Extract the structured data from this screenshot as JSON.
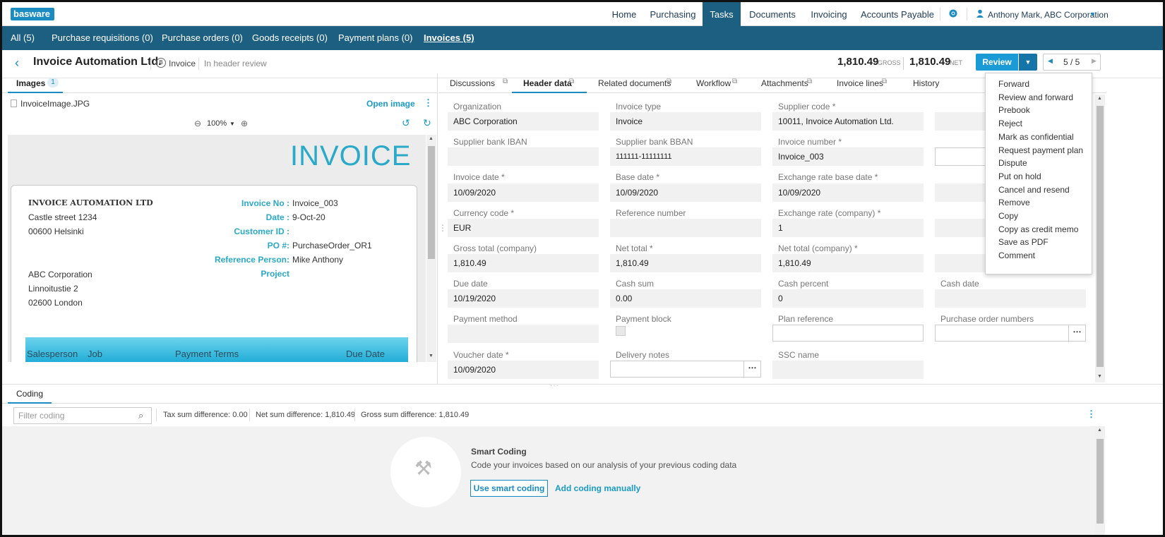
{
  "app": {
    "logo": "basware"
  },
  "top_nav": {
    "items": [
      "Home",
      "Purchasing",
      "Tasks",
      "Documents",
      "Invoicing",
      "Accounts Payable"
    ],
    "active": "Tasks",
    "user": "Anthony Mark, ABC Corporation"
  },
  "sub_nav": {
    "items": [
      "All (5)",
      "Purchase requisitions (0)",
      "Purchase orders (0)",
      "Goods receipts (0)",
      "Payment plans (0)",
      "Invoices (5)"
    ],
    "active": "Invoices (5)"
  },
  "header": {
    "title": "Invoice Automation Ltd.",
    "doc_type": "Invoice",
    "status": "In header review",
    "gross_value": "1,810.49",
    "gross_label": "GROSS",
    "net_value": "1,810.49",
    "net_label": "NET",
    "review_label": "Review",
    "pager": "5 / 5"
  },
  "images_panel": {
    "tab": "Images",
    "count": "1",
    "file": "InvoiceImage.JPG",
    "open_image": "Open image",
    "zoom": "100%"
  },
  "invoice_image": {
    "title": "INVOICE",
    "company": "INVOICE AUTOMATION LTD",
    "addr1": "Castle street 1234",
    "addr2": "00600 Helsinki",
    "to1": "ABC Corporation",
    "to2": "Linnoitustie 2",
    "to3": "02600 London",
    "labels": [
      "Invoice No :",
      "Date :",
      "Customer ID :",
      "PO #:",
      "Reference Person:",
      "Project"
    ],
    "values": [
      "Invoice_003",
      "9-Oct-20",
      "",
      "PurchaseOrder_OR1",
      "Mike Anthony",
      ""
    ],
    "table_cols": [
      "Salesperson",
      "Job",
      "Payment Terms",
      "Due Date"
    ]
  },
  "right_tabs": [
    "Discussions",
    "Header data",
    "Related documents",
    "Workflow",
    "Attachments",
    "Invoice lines",
    "History"
  ],
  "active_right_tab": "Header data",
  "fields": {
    "organization": {
      "label": "Organization",
      "value": "ABC Corporation"
    },
    "invoice_type": {
      "label": "Invoice type",
      "value": "Invoice"
    },
    "supplier_code": {
      "label": "Supplier code *",
      "value": "10011, Invoice Automation Ltd."
    },
    "bank_iban": {
      "label": "Supplier bank IBAN",
      "value": ""
    },
    "bank_bban": {
      "label": "Supplier bank BBAN",
      "value": "111111-11111111"
    },
    "invoice_number": {
      "label": "Invoice number *",
      "value": "Invoice_003"
    },
    "invoice_date": {
      "label": "Invoice date *",
      "value": "10/09/2020"
    },
    "base_date": {
      "label": "Base date *",
      "value": "10/09/2020"
    },
    "exch_base_date": {
      "label": "Exchange rate base date *",
      "value": "10/09/2020"
    },
    "currency": {
      "label": "Currency code *",
      "value": "EUR"
    },
    "reference": {
      "label": "Reference number",
      "value": ""
    },
    "exch_rate": {
      "label": "Exchange rate (company) *",
      "value": "1"
    },
    "gross_total": {
      "label": "Gross total (company)",
      "value": "1,810.49"
    },
    "net_total": {
      "label": "Net total *",
      "value": "1,810.49"
    },
    "net_total_co": {
      "label": "Net total (company) *",
      "value": "1,810.49"
    },
    "due_date": {
      "label": "Due date",
      "value": "10/19/2020"
    },
    "cash_sum": {
      "label": "Cash sum",
      "value": "0.00"
    },
    "cash_percent": {
      "label": "Cash percent",
      "value": "0"
    },
    "cash_date": {
      "label": "Cash date",
      "value": ""
    },
    "payment_method": {
      "label": "Payment method",
      "value": ""
    },
    "payment_block": {
      "label": "Payment block"
    },
    "plan_reference": {
      "label": "Plan reference"
    },
    "po_numbers": {
      "label": "Purchase order numbers"
    },
    "voucher_date": {
      "label": "Voucher date *",
      "value": "10/09/2020"
    },
    "delivery_notes": {
      "label": "Delivery notes"
    },
    "ssc_name": {
      "label": "SSC name",
      "value": ""
    }
  },
  "review_menu": [
    "Forward",
    "Review and forward",
    "Prebook",
    "Reject",
    "Mark as confidential",
    "Request payment plan",
    "Dispute",
    "Put on hold",
    "Cancel and resend",
    "Remove",
    "Copy",
    "Copy as credit memo",
    "Save as PDF",
    "Comment"
  ],
  "coding": {
    "tab": "Coding",
    "filter_placeholder": "Filter coding",
    "tax_diff": "Tax sum difference: 0.00",
    "net_diff": "Net sum difference: 1,810.49",
    "gross_diff": "Gross sum difference: 1,810.49",
    "smart_title": "Smart Coding",
    "smart_desc": "Code your invoices based on our analysis of your previous coding data",
    "use_smart": "Use smart coding",
    "add_manual": "Add coding manually"
  }
}
